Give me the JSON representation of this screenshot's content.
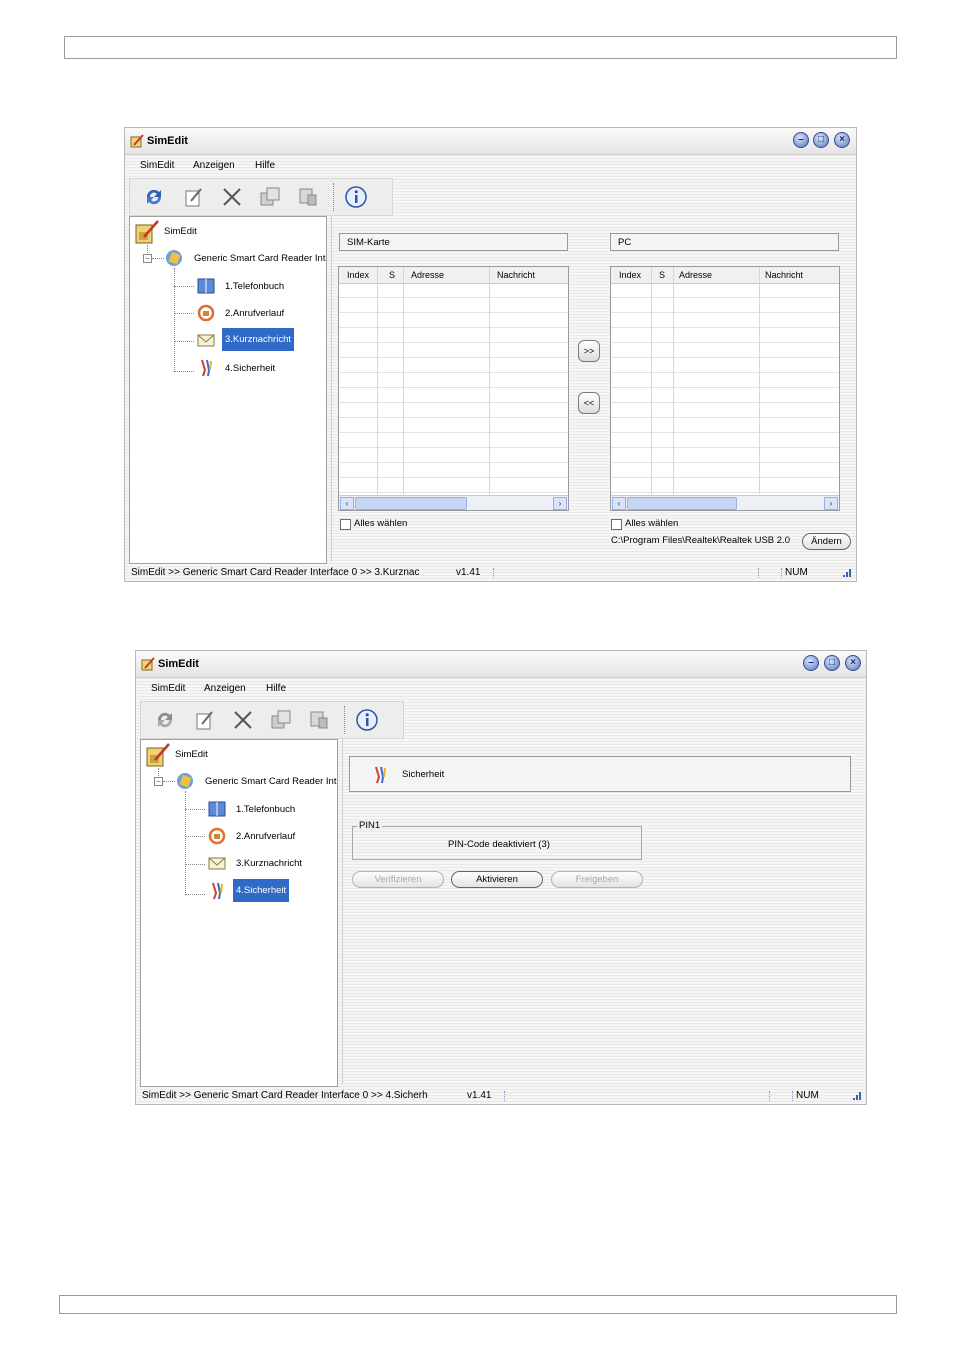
{
  "shot1": {
    "title": "SimEdit",
    "menu": [
      "SimEdit",
      "Anzeigen",
      "Hilfe"
    ],
    "tree": {
      "root": "SimEdit",
      "reader": "Generic Smart Card Reader Int",
      "items": [
        "1.Telefonbuch",
        "2.Anrufverlauf",
        "3.Kurznachricht",
        "4.Sicherheit"
      ],
      "selected": "3.Kurznachricht"
    },
    "left_panel": {
      "header": "SIM-Karte",
      "columns": [
        "Index",
        "S",
        "Adresse",
        "Nachricht"
      ],
      "select_all": "Alles wählen"
    },
    "right_panel": {
      "header": "PC",
      "columns": [
        "Index",
        "S",
        "Adresse",
        "Nachricht"
      ],
      "select_all": "Alles wählen",
      "path": "C:\\Program Files\\Realtek\\Realtek USB 2.0",
      "change_button": "Ändern"
    },
    "transfer": {
      "to_pc": ">>",
      "to_sim": "<<"
    },
    "status": {
      "path": "SimEdit  >>  Generic Smart Card Reader Interface 0  >>  3.Kurznac",
      "version": "v1.41",
      "num": "NUM"
    }
  },
  "shot2": {
    "title": "SimEdit",
    "menu": [
      "SimEdit",
      "Anzeigen",
      "Hilfe"
    ],
    "tree": {
      "root": "SimEdit",
      "reader": "Generic Smart Card Reader Int",
      "items": [
        "1.Telefonbuch",
        "2.Anrufverlauf",
        "3.Kurznachricht",
        "4.Sicherheit"
      ],
      "selected": "4.Sicherheit"
    },
    "header": "Sicherheit",
    "pin_group": {
      "legend": "PIN1",
      "status": "PIN-Code deaktiviert (3)"
    },
    "buttons": {
      "verify": "Verifizieren",
      "activate": "Aktivieren",
      "release": "Freigeben"
    },
    "status": {
      "path": "SimEdit  >>  Generic Smart Card Reader Interface 0  >>  4.Sicherh",
      "version": "v1.41",
      "num": "NUM"
    }
  },
  "icons": [
    "refresh-icon",
    "edit-icon",
    "delete-icon",
    "copy-icon",
    "paste-icon",
    "info-icon",
    "book-icon",
    "call-history-icon",
    "envelope-icon",
    "security-key-icon",
    "sim-card-icon",
    "card-reader-icon"
  ],
  "colors": {
    "selection": "#3169c6",
    "window_buttons": "#5f7bc4"
  }
}
